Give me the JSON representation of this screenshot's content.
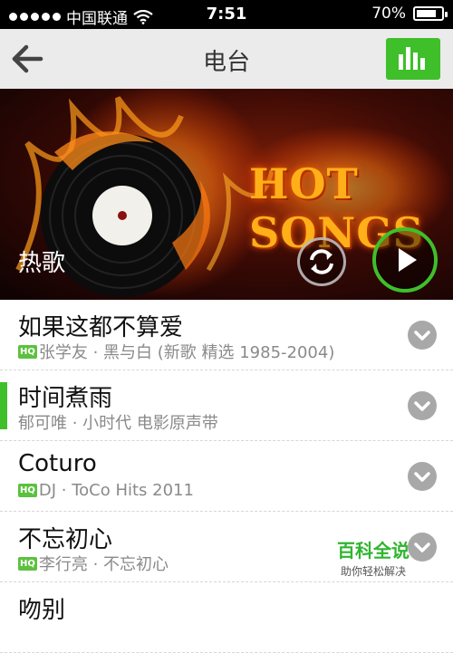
{
  "status_bar": {
    "carrier": "中国联通",
    "time": "7:51",
    "battery": "70%",
    "battery_level": 0.7
  },
  "nav": {
    "title": "电台",
    "back_icon": "arrow-left-icon",
    "equalizer_icon": "equalizer-bars-icon",
    "accent_color": "#3fbf2a"
  },
  "banner": {
    "title": "热歌",
    "artwork_text": "HOT SONGS",
    "refresh_icon": "refresh-icon",
    "play_icon": "play-icon"
  },
  "songs": [
    {
      "title": "如果这都不算爱",
      "hq": true,
      "subtitle": "张学友 · 黑与白 (新歌 精选 1985-2004)"
    },
    {
      "title": "时间煮雨",
      "hq": false,
      "subtitle": "郁可唯 · 小时代 电影原声带",
      "playing": true
    },
    {
      "title": "Coturo",
      "hq": true,
      "subtitle": "DJ · ToCo Hits 2011"
    },
    {
      "title": "不忘初心",
      "hq": true,
      "subtitle": "李行亮 · 不忘初心"
    },
    {
      "title": "吻别",
      "hq": false,
      "subtitle": ""
    }
  ],
  "watermark": {
    "main": "百科全说",
    "tagline": "助你轻松解决"
  }
}
